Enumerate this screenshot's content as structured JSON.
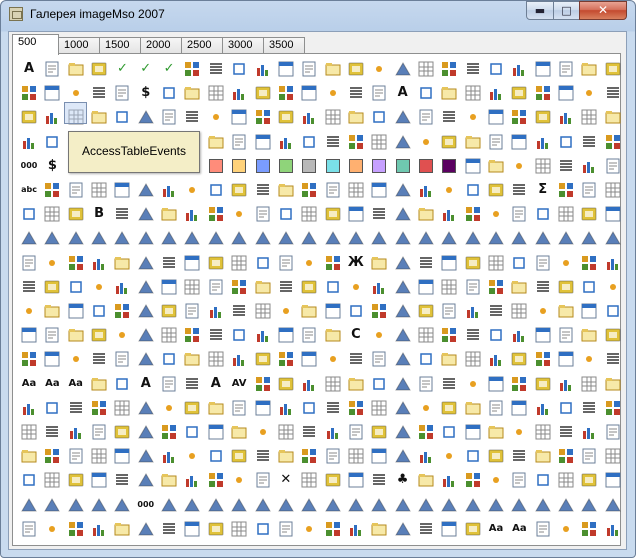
{
  "window": {
    "title": "Галерея imageMso 2007",
    "controls": {
      "minimize": "▬",
      "maximize": "□",
      "close": "✕"
    }
  },
  "tabs": [
    {
      "label": "500",
      "active": true
    },
    {
      "label": "1000"
    },
    {
      "label": "1500"
    },
    {
      "label": "2000"
    },
    {
      "label": "2500"
    },
    {
      "label": "3000"
    },
    {
      "label": "3500"
    }
  ],
  "tooltip": {
    "text": "AccessTableEvents"
  },
  "grid": {
    "cols": 26,
    "rows": 20,
    "icon_palette": [
      "#2f6fc2",
      "#4b8f2f",
      "#d99a1f",
      "#c03a2b",
      "#7b4ea3",
      "#2a9bb3",
      "#8a8a8a",
      "#e0c23a",
      "#5a7fb8",
      "#3f9b5a"
    ],
    "glyph_cells": [
      {
        "r": 0,
        "c": 0,
        "g": "A"
      },
      {
        "r": 0,
        "c": 4,
        "g": "✓"
      },
      {
        "r": 0,
        "c": 5,
        "g": "✓"
      },
      {
        "r": 0,
        "c": 6,
        "g": "✓"
      },
      {
        "r": 1,
        "c": 5,
        "g": "$"
      },
      {
        "r": 1,
        "c": 16,
        "g": "A"
      },
      {
        "r": 3,
        "c": 4,
        "g": "Σ"
      },
      {
        "r": 4,
        "c": 0,
        "g": "000"
      },
      {
        "r": 4,
        "c": 1,
        "g": "$"
      },
      {
        "r": 4,
        "c": 3,
        "g": "%"
      },
      {
        "r": 5,
        "c": 0,
        "g": "abc"
      },
      {
        "r": 5,
        "c": 22,
        "g": "Σ"
      },
      {
        "r": 6,
        "c": 3,
        "g": "B"
      },
      {
        "r": 8,
        "c": 14,
        "g": "Ж"
      },
      {
        "r": 11,
        "c": 14,
        "g": "С"
      },
      {
        "r": 13,
        "c": 0,
        "g": "Aa"
      },
      {
        "r": 13,
        "c": 1,
        "g": "Aa"
      },
      {
        "r": 13,
        "c": 2,
        "g": "Aa"
      },
      {
        "r": 13,
        "c": 5,
        "g": "A"
      },
      {
        "r": 13,
        "c": 8,
        "g": "A"
      },
      {
        "r": 13,
        "c": 9,
        "g": "AV"
      },
      {
        "r": 17,
        "c": 11,
        "g": "✕"
      },
      {
        "r": 17,
        "c": 16,
        "g": "♣"
      },
      {
        "r": 18,
        "c": 5,
        "g": "000"
      },
      {
        "r": 19,
        "c": 20,
        "g": "Aa"
      },
      {
        "r": 19,
        "c": 21,
        "g": "Aa"
      }
    ],
    "swatch_row": {
      "r": 4,
      "start": 8,
      "colors": [
        "#ff8c7a",
        "#ffd27a",
        "#7a9cff",
        "#8fd47a",
        "#b8b8b8",
        "#7ae0e8",
        "#ffb070",
        "#c6a0ff",
        "#6fc8b0",
        "#e05050",
        "#5a0060"
      ]
    }
  }
}
